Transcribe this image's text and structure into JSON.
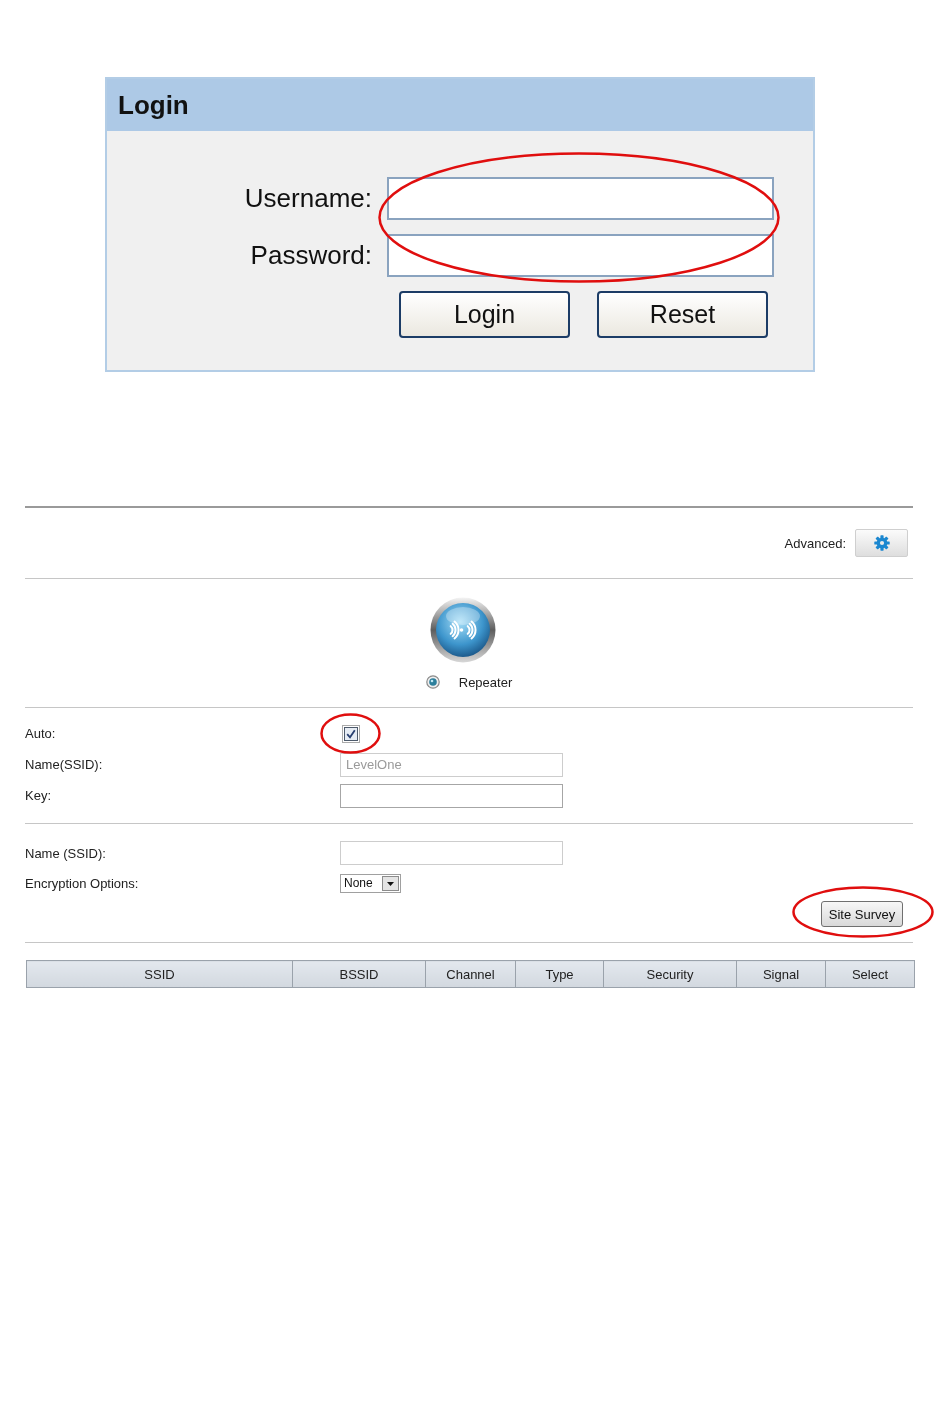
{
  "login": {
    "title": "Login",
    "fields": [
      {
        "label": "Username:"
      },
      {
        "label": "Password:"
      }
    ],
    "fields_circled": true,
    "buttons": [
      {
        "label": "Login"
      },
      {
        "label": "Reset"
      }
    ]
  },
  "repeater_setup": {
    "advanced": {
      "label": "Advanced:"
    },
    "mode": {
      "label": "Repeater",
      "selected": true
    },
    "settings": [
      {
        "rows": [
          {
            "kind": "checkbox",
            "label": "Auto:",
            "checked": true,
            "circled": true
          },
          {
            "kind": "text",
            "label": "Name(SSID):",
            "value": "LevelOne",
            "disabled": true
          },
          {
            "kind": "text",
            "label": "Key:",
            "disabled": false
          }
        ]
      },
      {
        "rows": [
          {
            "kind": "text",
            "label": "Name (SSID):",
            "disabled": true
          },
          {
            "kind": "select",
            "label": "Encryption Options:",
            "value": "None"
          }
        ]
      }
    ],
    "site_survey": {
      "label": "Site Survey",
      "circled": true
    },
    "table": {
      "columns": [
        "SSID",
        "BSSID",
        "Channel",
        "Type",
        "Security",
        "Signal",
        "Select"
      ]
    }
  }
}
